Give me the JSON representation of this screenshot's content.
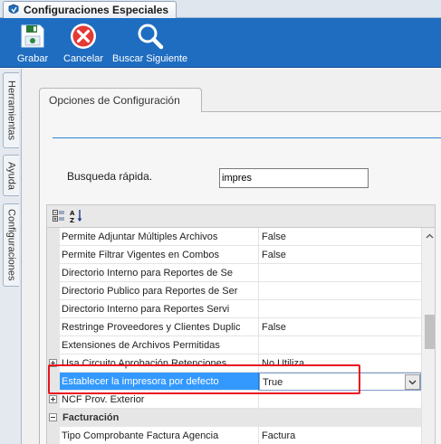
{
  "window": {
    "tab_title": "Configuraciones Especiales",
    "tab_icon": "app-icon"
  },
  "toolbar": {
    "save_label": "Grabar",
    "cancel_label": "Cancelar",
    "find_next_label": "Buscar Siguiente",
    "background": "#1f6dc0"
  },
  "side_tabs": [
    "Herramientas",
    "Ayuda",
    "Configuraciones"
  ],
  "panel": {
    "title": "Opciones de Configuración"
  },
  "quick_search": {
    "label": "Busqueda rápida.",
    "value": "impres"
  },
  "grid": {
    "toolbar_icons": [
      "categorized-view-icon",
      "alphabetical-sort-icon"
    ],
    "rows": [
      {
        "name": "Permite Adjuntar Múltiples Archivos",
        "value": "False"
      },
      {
        "name": "Permite Filtrar Vigentes en Combos",
        "value": "False"
      },
      {
        "name": "Directorio Interno para Reportes de Se",
        "value": ""
      },
      {
        "name": "Directorio Publico para Reportes de Ser",
        "value": ""
      },
      {
        "name": "Directorio Interno para Reportes Servi",
        "value": ""
      },
      {
        "name": "Restringe Proveedores y Clientes Duplic",
        "value": "False"
      },
      {
        "name": "Extensiones de Archivos Permitidas",
        "value": ""
      },
      {
        "name": "Usa Circuito Aprobación Retenciones",
        "value": "No Utiliza"
      },
      {
        "name": "Establecer la impresora por defecto",
        "value": "True"
      },
      {
        "name": "NCF Prov. Exterior",
        "value": ""
      }
    ],
    "category": "Facturación",
    "category_rows": [
      {
        "name": "Tipo Comprobante Factura Agencia",
        "value": "Factura"
      }
    ],
    "selected_color": "#3399ff"
  },
  "highlight_color": "#e8141e"
}
